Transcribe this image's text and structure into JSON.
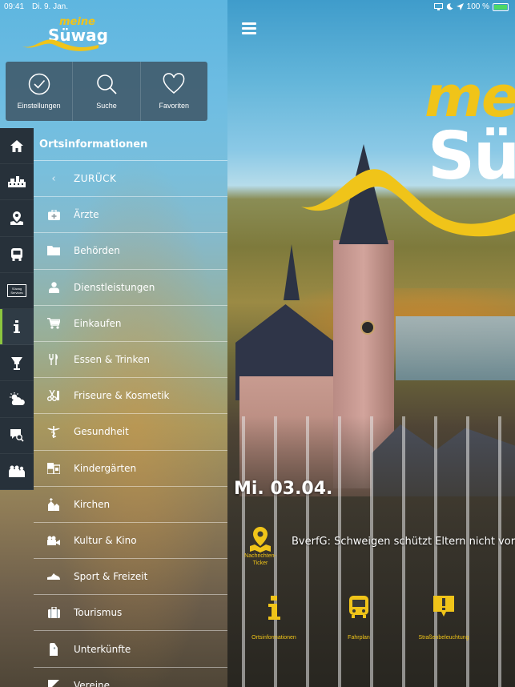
{
  "status_bar": {
    "time": "09:41",
    "date": "Di. 9. Jan.",
    "battery": "100 %"
  },
  "panel": {
    "logo": {
      "line1": "meine",
      "line2": "Süwag"
    },
    "quick_actions": [
      {
        "label": "Einstellungen",
        "icon": "check-circle-icon"
      },
      {
        "label": "Suche",
        "icon": "search-icon"
      },
      {
        "label": "Favoriten",
        "icon": "heart-icon"
      }
    ],
    "rail": [
      {
        "icon": "home-icon",
        "label": ""
      },
      {
        "icon": "city-icon",
        "label": ""
      },
      {
        "icon": "map-pin-icon",
        "label": ""
      },
      {
        "icon": "bus-icon",
        "label": ""
      },
      {
        "icon": "suewag-services-icon",
        "label": "Süwag Services"
      },
      {
        "icon": "info-icon",
        "label": "",
        "active": true
      },
      {
        "icon": "health-icon",
        "label": ""
      },
      {
        "icon": "weather-icon",
        "label": ""
      },
      {
        "icon": "chat-search-icon",
        "label": ""
      },
      {
        "icon": "people-icon",
        "label": ""
      }
    ],
    "section_title": "Ortsinformationen",
    "menu": [
      {
        "label": "ZURÜCK",
        "icon": "chevron-left-icon",
        "glyph": "‹"
      },
      {
        "label": "Ärzte",
        "icon": "medical-kit-icon",
        "glyph": "✚"
      },
      {
        "label": "Behörden",
        "icon": "folder-icon",
        "glyph": "▰"
      },
      {
        "label": "Dienstleistungen",
        "icon": "person-icon",
        "glyph": "♟"
      },
      {
        "label": "Einkaufen",
        "icon": "cart-icon",
        "glyph": "🛒"
      },
      {
        "label": "Essen & Trinken",
        "icon": "cutlery-icon",
        "glyph": "Ψ"
      },
      {
        "label": "Friseure & Kosmetik",
        "icon": "scissors-icon",
        "glyph": "✂"
      },
      {
        "label": "Gesundheit",
        "icon": "caduceus-icon",
        "glyph": "⚕"
      },
      {
        "label": "Kindergärten",
        "icon": "blocks-icon",
        "glyph": "▣"
      },
      {
        "label": "Kirchen",
        "icon": "church-icon",
        "glyph": "⛪"
      },
      {
        "label": "Kultur & Kino",
        "icon": "camera-icon",
        "glyph": "▶"
      },
      {
        "label": "Sport & Freizeit",
        "icon": "shoe-icon",
        "glyph": "◢"
      },
      {
        "label": "Tourismus",
        "icon": "suitcase-icon",
        "glyph": "▤"
      },
      {
        "label": "Unterkünfte",
        "icon": "bed-icon",
        "glyph": "▮"
      },
      {
        "label": "Vereine",
        "icon": "flag-icon",
        "glyph": "◩"
      }
    ]
  },
  "main": {
    "logo": {
      "line1": "mei",
      "line2": "Sü"
    },
    "date": "Mi. 03.04.",
    "ticker": {
      "label": "Nachrichten-Ticker",
      "text": "BverfG: Schweigen schützt Eltern nicht vor Haft"
    },
    "dock": [
      {
        "label": "Ortsinformationen",
        "icon": "info-icon"
      },
      {
        "label": "Fahrplan",
        "icon": "bus-icon"
      },
      {
        "label": "Straßenbeleuchtung",
        "icon": "warning-icon"
      }
    ]
  },
  "colors": {
    "accent": "#f0c419",
    "rail_bg": "#27313a",
    "active_indicator": "#8cc63f"
  }
}
